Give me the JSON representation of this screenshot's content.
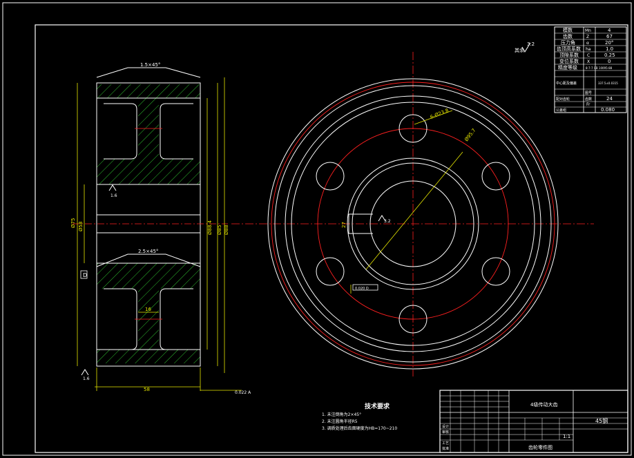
{
  "drawing": {
    "surface_finish_symbol": "3.2",
    "surface_finish_note": "其余",
    "left_view_dims": {
      "top_chamfer": "1.5×45°",
      "mid_chamfer": "2.5×45°",
      "rough_a": "1.6",
      "rough_b": "1.6",
      "rough_c": "1.6",
      "dia_a": "Ø75",
      "dia_b": "Ø58",
      "dia_c": "Ø88.4",
      "dia_d": "Ø85",
      "dia_e": "Ø88",
      "web": "16",
      "width": "58",
      "datum": "D",
      "runout": "0.022 A"
    },
    "front_view_dims": {
      "hole_dia": "6-Ø23.8",
      "pcd": "Ø95.7",
      "keyway": "27",
      "key_rough": "3.2",
      "sym_tol": "0.020 D"
    },
    "param_table": {
      "rows": [
        {
          "name": "模数",
          "sym": "Mn",
          "val": "4"
        },
        {
          "name": "齿数",
          "sym": "Z",
          "val": "67"
        },
        {
          "name": "压力角",
          "sym": "α",
          "val": "20°"
        },
        {
          "name": "齿顶高系数",
          "sym": "ha",
          "val": "1.0"
        },
        {
          "name": "顶隙系数",
          "sym": "C",
          "val": "0.25"
        },
        {
          "name": "变位系数",
          "sym": "X",
          "val": "0"
        },
        {
          "name": "精度等级",
          "sym": "",
          "val": "8-7-7  GB 10095-88"
        },
        {
          "name": "中心距及偏差",
          "sym": "",
          "val": "337.5±0.0315"
        },
        {
          "name": "配对齿轮",
          "sym": "图号",
          "val": ""
        },
        {
          "name": "",
          "sym": "齿数",
          "val": "24"
        },
        {
          "name": "公差组",
          "sym": "Fr",
          "val": "0.080"
        }
      ]
    },
    "tech_req": {
      "title": "技术要求",
      "items": [
        "1.   未注倒角为2×45°",
        "2.   未注圆角半径R5",
        "3.   调质处理后齿面硬度为HB=170~210"
      ]
    },
    "title_block": {
      "part_name": "4级传动大齿",
      "material": "45钢",
      "scale": "1:1",
      "drawing_no": "齿轮零件图",
      "org": "",
      "designer": "",
      "date": "",
      "mark_1": "设计",
      "mark_2": "审核",
      "mark_3": "工艺",
      "mark_4": "批准"
    },
    "colors": {
      "outline": "#ffffff",
      "dimension": "#e8e800",
      "centerline": "#ff2020",
      "hatch": "#2fbf2f"
    }
  }
}
